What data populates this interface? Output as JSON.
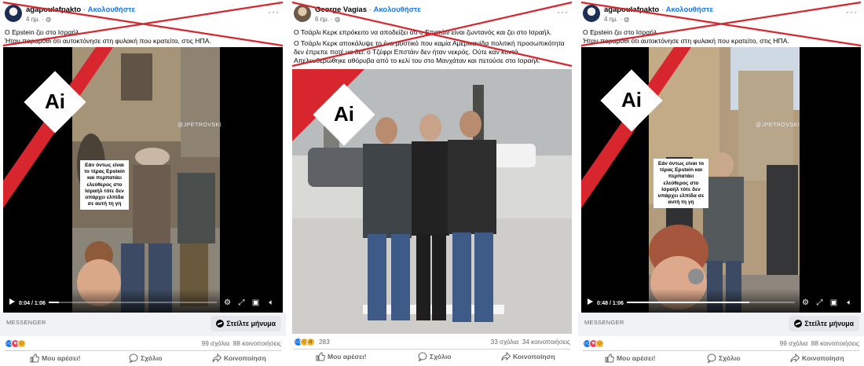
{
  "posts": [
    {
      "author": "agapoulafpakto",
      "separator": "·",
      "follow_label": "Ακολουθήστε",
      "time": "4 ημ. ·",
      "caption_lines": [
        "Ο Epstein ζει στο Ισραήλ.",
        "Ήταν παραμύθι ότι αυτοκτόνησε στη φυλακή που κρατείτο, στις ΗΠΑ."
      ],
      "ai_badge": "Ai",
      "watermark": "@JPETROVSKI",
      "video_overlay": "Εάν όντως είναι το τέρας Epstein και περπατάει ελεύθερος στο Ισραήλ τότε δεν υπάρχει ελπίδα σε αυτή τη γη",
      "video_time": "0:04 / 1:06",
      "progress": 0.06,
      "messenger_label": "MESSENGER",
      "send_message": "Στείλτε μήνυμα",
      "reaction_count": "",
      "comments": "99 σχόλια",
      "shares": "88 κοινοποιήσεις",
      "like": "Μου αρέσει!",
      "comment": "Σχόλιο",
      "share": "Κοινοποίηση"
    },
    {
      "author": "George Vagias",
      "separator": "·",
      "follow_label": "Ακολουθήστε",
      "time": "6 ημ. ·",
      "caption_lines": [
        "Ο Τσάρλι Κερκ επρόκειτο να αποδείξει ότι ο Επστάιν είναι ζωντανός και ζει στο Ισραήλ.",
        "Ο Τσάρλι Κερκ αποκάλυψε το ένα μυστικό που καμία Αμερικανίδα πολιτική προσωπικότητα δεν έπρεπε ποτέ να δει: ο Τζέφρι Επστάιν δεν ήταν νεκρός. Ούτε καν κοντά. Απελευθερώθηκε αθόρυβα από το κελί του στο Μανχάταν και πετούσε στο Ισραήλ."
      ],
      "ai_badge": "Ai",
      "watermark": "",
      "video_overlay": "",
      "video_time": "",
      "progress": 0,
      "messenger_label": "",
      "send_message": "",
      "reaction_count": "283",
      "comments": "33 σχόλια",
      "shares": "34 κοινοποιήσεις",
      "like": "Μου αρέσει!",
      "comment": "Σχόλιο",
      "share": "Κοινοποίηση"
    },
    {
      "author": "agapoulafpakto",
      "separator": "·",
      "follow_label": "Ακολουθήστε",
      "time": "4 ημ. ·",
      "caption_lines": [
        "Ο Epstein ζει στο Ισραήλ.",
        "Ήταν παραμύθι ότι αυτοκτόνησε στη φυλακή που κρατείτο, στις ΗΠΑ."
      ],
      "ai_badge": "Ai",
      "watermark": "@JPETROVSKI",
      "video_overlay": "Εάν όντως είναι το τέρας Epstein και περπατάει ελεύθερος στο Ισραήλ τότε δεν υπάρχει ελπίδα σε αυτή τη γη",
      "video_time": "0:48 / 1:06",
      "progress": 0.73,
      "messenger_label": "MESSENGER",
      "send_message": "Στείλτε μήνυμα",
      "reaction_count": "",
      "comments": "99 σχόλια",
      "shares": "88 κοινοποιήσεις",
      "like": "Μου αρέσει!",
      "comment": "Σχόλιο",
      "share": "Κοινοποίηση"
    }
  ],
  "colors": {
    "strike_red": "#d7262e",
    "brand_blue": "#1877f2",
    "video_bg": "#000000"
  }
}
